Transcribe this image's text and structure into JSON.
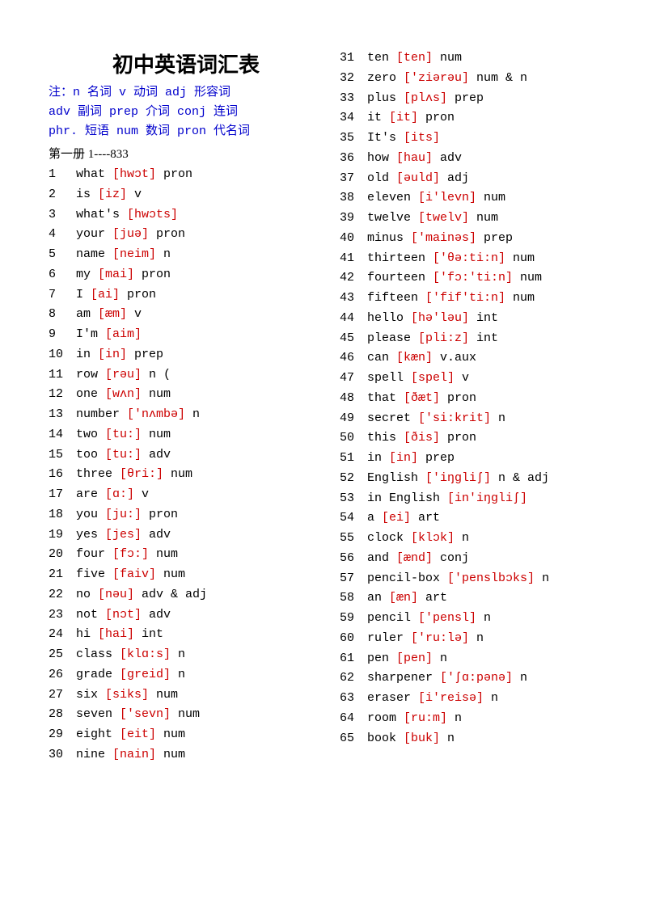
{
  "title": "初中英语词汇表",
  "legend": [
    "注：n 名词    v 动词      adj 形容词",
    "adv 副词    prep 介词   conj 连词",
    "phr. 短语    num 数词    pron 代名词"
  ],
  "section": "第一册 1----833",
  "left": [
    {
      "n": "1",
      "w": "what",
      "i": "[hwɔt]",
      "p": "pron"
    },
    {
      "n": "2",
      "w": "is",
      "i": "[iz]",
      "p": "v"
    },
    {
      "n": "3",
      "w": "what's",
      "i": "[hwɔts]",
      "p": ""
    },
    {
      "n": "4",
      "w": "your",
      "i": "[juə]",
      "p": "pron"
    },
    {
      "n": "5",
      "w": "name",
      "i": "[neim]",
      "p": "n"
    },
    {
      "n": "6",
      "w": "my",
      "i": "[mai]",
      "p": "pron"
    },
    {
      "n": "7",
      "w": "I ",
      "i": "[ai]",
      "p": "pron"
    },
    {
      "n": "8",
      "w": "am",
      "i": "[æm]",
      "p": "v"
    },
    {
      "n": "9",
      "w": "I'm ",
      "i": "[aim]",
      "p": ""
    },
    {
      "n": "10",
      "w": "in",
      "i": "[in]",
      "p": "prep"
    },
    {
      "n": "11",
      "w": "row",
      "i": "[rəu]",
      "p": "n ("
    },
    {
      "n": "12",
      "w": "one",
      "i": "[wʌn]",
      "p": "num"
    },
    {
      "n": "13",
      "w": "number",
      "i": "['nʌmbə]",
      "p": "n"
    },
    {
      "n": "14",
      "w": "two",
      "i": "[tu:]",
      "p": "num"
    },
    {
      "n": "15",
      "w": "too",
      "i": "[tu:]",
      "p": "adv"
    },
    {
      "n": "16",
      "w": "three",
      "i": "[θri:]",
      "p": "num"
    },
    {
      "n": "17",
      "w": "are",
      "i": "[ɑ:]",
      "p": "v"
    },
    {
      "n": "18",
      "w": "you",
      "i": "[ju:]",
      "p": "pron"
    },
    {
      "n": "19",
      "w": "yes",
      "i": "[jes]",
      "p": "adv"
    },
    {
      "n": "20",
      "w": "four",
      "i": "[fɔ:]",
      "p": "num"
    },
    {
      "n": "21",
      "w": "five",
      "i": "[faiv]",
      "p": "num"
    },
    {
      "n": "22",
      "w": "no",
      "i": "[nəu]",
      "p": "adv & adj"
    },
    {
      "n": "23",
      "w": "not",
      "i": "[nɔt]",
      "p": "adv"
    },
    {
      "n": "24",
      "w": "hi",
      "i": "[hai]",
      "p": "int"
    },
    {
      "n": "25",
      "w": "class",
      "i": "[klɑ:s]",
      "p": "n"
    },
    {
      "n": "26",
      "w": "grade",
      "i": "[greid]",
      "p": "n"
    },
    {
      "n": "27",
      "w": "six",
      "i": "[siks]",
      "p": "num"
    },
    {
      "n": "28",
      "w": "seven",
      "i": "['sevn]",
      "p": "num"
    },
    {
      "n": "29",
      "w": "eight",
      "i": "[eit]",
      "p": "num"
    },
    {
      "n": "30",
      "w": "nine",
      "i": "[nain]",
      "p": "num"
    }
  ],
  "right": [
    {
      "n": "31",
      "w": "ten",
      "i": "[ten]",
      "p": "num"
    },
    {
      "n": "32",
      "w": "zero",
      "i": "['ziərəu]",
      "p": "num & n"
    },
    {
      "n": "33",
      "w": "plus",
      "i": "[plʌs]",
      "p": " prep"
    },
    {
      "n": "34",
      "w": "it",
      "i": "[it]",
      "p": "pron"
    },
    {
      "n": "35",
      "w": "It's",
      "i": "[its]",
      "p": ""
    },
    {
      "n": "36",
      "w": "how",
      "i": "[hau]",
      "p": "adv"
    },
    {
      "n": "37",
      "w": "old",
      "i": "[əuld]",
      "p": "adj"
    },
    {
      "n": "38",
      "w": "eleven",
      "i": "[i'levn]",
      "p": "num"
    },
    {
      "n": "39",
      "w": "twelve",
      "i": "[twelv]",
      "p": "num"
    },
    {
      "n": "40",
      "w": "minus",
      "i": "['mainəs]",
      "p": "prep"
    },
    {
      "n": "41",
      "w": "thirteen",
      "i": "['θə:ti:n]",
      "p": "num"
    },
    {
      "n": "42",
      "w": "fourteen",
      "i": "['fɔ:'ti:n]",
      "p": "num"
    },
    {
      "n": "43",
      "w": "fifteen",
      "i": "['fif'ti:n]",
      "p": "num"
    },
    {
      "n": "44",
      "w": "hello",
      "i": "[hə'ləu]",
      "p": "int"
    },
    {
      "n": "45",
      "w": "please",
      "i": "[pli:z]",
      "p": "int"
    },
    {
      "n": "46",
      "w": "can",
      "i": "[kæn]",
      "p": "v.aux"
    },
    {
      "n": "47",
      "w": "spell",
      "i": "[spel]",
      "p": "v"
    },
    {
      "n": "48",
      "w": "that",
      "i": "[ðæt]",
      "p": "pron"
    },
    {
      "n": "49",
      "w": "secret",
      "i": "['si:krit]",
      "p": "n"
    },
    {
      "n": "50",
      "w": "this",
      "i": "[ðis]",
      "p": "pron"
    },
    {
      "n": "51",
      "w": "in",
      "i": "[in]",
      "p": "prep"
    },
    {
      "n": "52",
      "w": "English",
      "i": "['iŋgliʃ]",
      "p": "n & adj"
    },
    {
      "n": "53",
      "w": "in English",
      "i": "[in'iŋgliʃ]",
      "p": ""
    },
    {
      "n": "54",
      "w": "a",
      "i": "[ei]",
      "p": "art"
    },
    {
      "n": "55",
      "w": "clock",
      "i": "[klɔk]",
      "p": "n"
    },
    {
      "n": "56",
      "w": "and",
      "i": "[ænd]",
      "p": "conj"
    },
    {
      "n": "57",
      "w": "pencil-box",
      "i": "['penslbɔks]",
      "p": "n"
    },
    {
      "n": "58",
      "w": "an",
      "i": "[æn]",
      "p": "art"
    },
    {
      "n": "59",
      "w": "pencil",
      "i": "['pensl]",
      "p": "n"
    },
    {
      "n": "60",
      "w": "ruler",
      "i": "['ru:lə]",
      "p": "n"
    },
    {
      "n": "61",
      "w": "pen",
      "i": "[pen]",
      "p": "n"
    },
    {
      "n": "62",
      "w": "sharpener",
      "i": "['ʃɑ:pənə]",
      "p": "n"
    },
    {
      "n": "63",
      "w": "eraser",
      "i": "[i'reisə]",
      "p": "n"
    },
    {
      "n": "64",
      "w": "room",
      "i": "[ru:m]",
      "p": "n"
    },
    {
      "n": "65",
      "w": "book",
      "i": "[buk]",
      "p": "n"
    }
  ]
}
